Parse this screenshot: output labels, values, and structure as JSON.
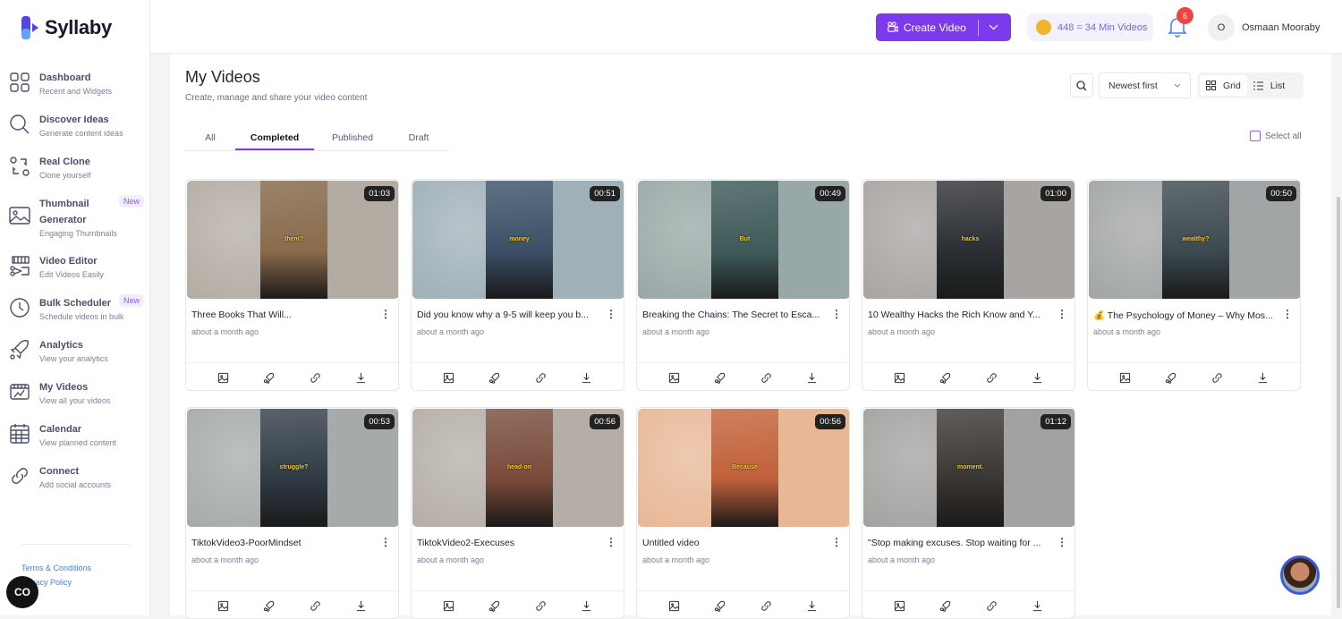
{
  "brand": {
    "name": "Syllaby"
  },
  "sidebar": {
    "items": [
      {
        "title": "Dashboard",
        "sub": "Recent and Widgets",
        "icon": "grid-icon"
      },
      {
        "title": "Discover Ideas",
        "sub": "Generate content ideas",
        "icon": "search-icon"
      },
      {
        "title": "Real Clone",
        "sub": "Clone yourself",
        "icon": "clone-icon"
      },
      {
        "title": "Thumbnail Generator",
        "sub": "Engaging Thumbnails",
        "icon": "image-icon",
        "badge": "New"
      },
      {
        "title": "Video Editor",
        "sub": "Edit Videos Easily",
        "icon": "film-scissors-icon"
      },
      {
        "title": "Bulk Scheduler",
        "sub": "Schedule videos in bulk",
        "icon": "clock-icon",
        "badge": "New"
      },
      {
        "title": "Analytics",
        "sub": "View your analytics",
        "icon": "rocket-icon"
      },
      {
        "title": "My Videos",
        "sub": "View all your videos",
        "icon": "videos-icon"
      },
      {
        "title": "Calendar",
        "sub": "View planned content",
        "icon": "calendar-icon"
      },
      {
        "title": "Connect",
        "sub": "Add social accounts",
        "icon": "link-icon"
      }
    ],
    "footer": {
      "terms": "Terms & Conditions",
      "privacy": "Privacy Policy"
    },
    "co_button": "CO"
  },
  "header": {
    "create_label": "Create Video",
    "credits": "448 = 34 Min Videos",
    "notifications": "6",
    "avatar_initial": "O",
    "user_name": "Osmaan Mooraby"
  },
  "page": {
    "title": "My Videos",
    "subtitle": "Create, manage and share your video content",
    "tabs": [
      "All",
      "Completed",
      "Published",
      "Draft"
    ],
    "active_tab": "Completed",
    "sort": "Newest first",
    "view_grid": "Grid",
    "view_list": "List",
    "select_all": "Select all"
  },
  "videos": [
    {
      "title": "Three Books That Will...",
      "date": "about a month ago",
      "duration": "01:03",
      "caption": "them?",
      "bg": "#b3aca3",
      "fg": "#8a6a4a"
    },
    {
      "title": "Did you know why a 9-5 will keep you b...",
      "date": "about a month ago",
      "duration": "00:51",
      "caption": "money",
      "bg": "#9fb0b8",
      "fg": "#3b4f66"
    },
    {
      "title": "Breaking the Chains: The Secret to Esca...",
      "date": "about a month ago",
      "duration": "00:49",
      "caption": "But",
      "bg": "#98a8a6",
      "fg": "#3f5a5a"
    },
    {
      "title": "10 Wealthy Hacks the Rich Know and Y...",
      "date": "about a month ago",
      "duration": "01:00",
      "caption": "hacks",
      "bg": "#a8a4a2",
      "fg": "#2a2e33"
    },
    {
      "title": "💰 The Psychology of Money – Why Mos...",
      "date": "about a month ago",
      "duration": "00:50",
      "caption": "wealthy?",
      "bg": "#a2a5a6",
      "fg": "#3c4a50"
    },
    {
      "title": "TiktokVideo3-PoorMindset",
      "date": "about a month ago",
      "duration": "00:53",
      "caption": "struggle?",
      "bg": "#a6aaab",
      "fg": "#2f3a44"
    },
    {
      "title": "TiktokVideo2-Execuses",
      "date": "about a month ago",
      "duration": "00:56",
      "caption": "head-on",
      "bg": "#b4aea6",
      "fg": "#7a4a3a"
    },
    {
      "title": "Untitled video",
      "date": "about a month ago",
      "duration": "00:56",
      "caption": "Because",
      "bg": "#e8b896",
      "fg": "#c0603a"
    },
    {
      "title": "\"Stop making excuses. Stop waiting for ...",
      "date": "about a month ago",
      "duration": "01:12",
      "caption": "moment.",
      "bg": "#a4a2a0",
      "fg": "#3a3632"
    }
  ]
}
